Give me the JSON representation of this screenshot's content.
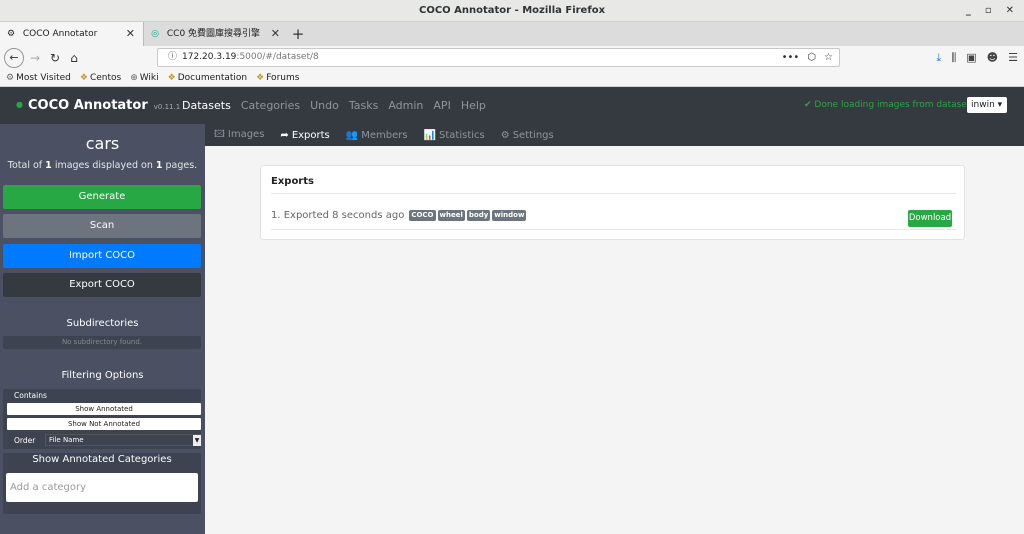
{
  "window": {
    "title": "COCO Annotator - Mozilla Firefox",
    "controls": [
      "_",
      "▫",
      "✕"
    ]
  },
  "tabs": [
    {
      "label": "COCO Annotator",
      "close": "✕"
    },
    {
      "label": "CC0 免費圖庫搜尋引擎",
      "close": "✕"
    }
  ],
  "newtab": "+",
  "urlbar": {
    "info": "ⓘ",
    "host": "172.20.3.19",
    "rest": ":5000/#/dataset/8",
    "more": "•••",
    "pocket": "⬡",
    "star": "☆"
  },
  "bookmarks": [
    {
      "icon": "⚙",
      "label": "Most Visited"
    },
    {
      "icon": "❖",
      "label": "Centos"
    },
    {
      "icon": "⊕",
      "label": "Wiki"
    },
    {
      "icon": "❖",
      "label": "Documentation"
    },
    {
      "icon": "❖",
      "label": "Forums"
    }
  ],
  "app": {
    "brand": "COCO Annotator",
    "version": "v0.11.1",
    "menu": [
      "Datasets",
      "Categories",
      "Undo",
      "Tasks",
      "Admin",
      "API",
      "Help"
    ],
    "status": "✔ Done loading images from dataset",
    "user": "inwin ▾"
  },
  "sidebar": {
    "title": "cars",
    "total_pre": "Total of ",
    "total_images": "1",
    "total_mid": " images displayed on ",
    "total_pages": "1",
    "total_post": " pages.",
    "buttons": {
      "generate": "Generate",
      "scan": "Scan",
      "import": "Import COCO",
      "export": "Export COCO"
    },
    "subdir_heading": "Subdirectories",
    "subdir_empty": "No subdirectory found.",
    "filter_heading": "Filtering Options",
    "contains_label": "Contains",
    "show_annotated": "Show Annotated",
    "show_not_annotated": "Show Not Annotated",
    "order_label": "Order",
    "order_value": "File Name",
    "cats_heading": "Show Annotated Categories",
    "cats_placeholder": "Add a category"
  },
  "subnav": [
    {
      "icon": "🖾",
      "label": "Images"
    },
    {
      "icon": "➦",
      "label": "Exports"
    },
    {
      "icon": "👥",
      "label": "Members"
    },
    {
      "icon": "📊",
      "label": "Statistics"
    },
    {
      "icon": "⚙",
      "label": "Settings"
    }
  ],
  "exports": {
    "heading": "Exports",
    "items": [
      {
        "text": "1. Exported 8 seconds ago",
        "tags": [
          "COCO",
          "wheel",
          "body",
          "window"
        ],
        "download": "Download"
      }
    ]
  },
  "colors": {
    "success": "#28a745",
    "primary": "#007bff",
    "navbar": "#343a40",
    "sidebar": "#4b5162"
  }
}
